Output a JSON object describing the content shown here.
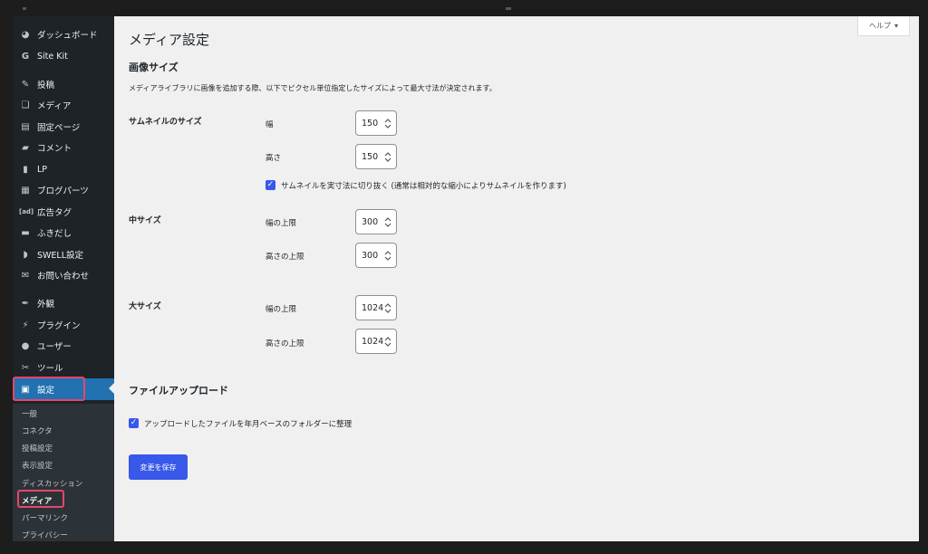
{
  "sidebar": {
    "items": [
      {
        "icon": "dashboard-icon",
        "glyph": "◕",
        "label": "ダッシュボード"
      },
      {
        "icon": "google-icon",
        "glyph": "G",
        "label": "Site Kit"
      },
      {
        "icon": "pin-icon",
        "glyph": "✎",
        "label": "投稿"
      },
      {
        "icon": "media-icon",
        "glyph": "❑",
        "label": "メディア"
      },
      {
        "icon": "page-icon",
        "glyph": "▤",
        "label": "固定ページ"
      },
      {
        "icon": "comment-icon",
        "glyph": "▰",
        "label": "コメント"
      },
      {
        "icon": "document-icon",
        "glyph": "▮",
        "label": "LP"
      },
      {
        "icon": "blocks-icon",
        "glyph": "▦",
        "label": "ブログパーツ"
      },
      {
        "icon": "ad-icon",
        "glyph": "[ad]",
        "label": "広告タグ"
      },
      {
        "icon": "balloon-icon",
        "glyph": "▬",
        "label": "ふきだし"
      },
      {
        "icon": "swell-icon",
        "glyph": "◗",
        "label": "SWELL設定"
      },
      {
        "icon": "mail-icon",
        "glyph": "✉",
        "label": "お問い合わせ"
      },
      {
        "icon": "brush-icon",
        "glyph": "✒",
        "label": "外観"
      },
      {
        "icon": "plugin-icon",
        "glyph": "⚡",
        "label": "プラグイン"
      },
      {
        "icon": "user-icon",
        "glyph": "●",
        "label": "ユーザー"
      },
      {
        "icon": "wrench-icon",
        "glyph": "✂",
        "label": "ツール"
      },
      {
        "icon": "settings-icon",
        "glyph": "▣",
        "label": "設定"
      }
    ],
    "submenu": [
      "一般",
      "コネクタ",
      "投稿設定",
      "表示設定",
      "ディスカッション",
      "メディア",
      "パーマリンク",
      "プライバシー"
    ]
  },
  "help": {
    "label": "ヘルプ",
    "arrow": "▾"
  },
  "page": {
    "title": "メディア設定",
    "image_sizes": {
      "heading": "画像サイズ",
      "description": "メディアライブラリに画像を追加する際、以下でピクセル単位指定したサイズによって最大寸法が決定されます。",
      "thumbnail": {
        "label": "サムネイルのサイズ",
        "width_label": "幅",
        "width": "150",
        "height_label": "高さ",
        "height": "150",
        "crop_label": "サムネイルを実寸法に切り抜く (通常は相対的な縮小によりサムネイルを作ります)"
      },
      "medium": {
        "label": "中サイズ",
        "width_label": "幅の上限",
        "width": "300",
        "height_label": "高さの上限",
        "height": "300"
      },
      "large": {
        "label": "大サイズ",
        "width_label": "幅の上限",
        "width": "1024",
        "height_label": "高さの上限",
        "height": "1024"
      }
    },
    "uploads": {
      "heading": "ファイルアップロード",
      "organize_label": "アップロードしたファイルを年月ベースのフォルダーに整理"
    },
    "save_label": "変更を保存"
  },
  "colors": {
    "accent": "#3858e9",
    "sidebar_bg": "#1d2327",
    "active": "#2271b1",
    "highlight": "#e8456b"
  }
}
